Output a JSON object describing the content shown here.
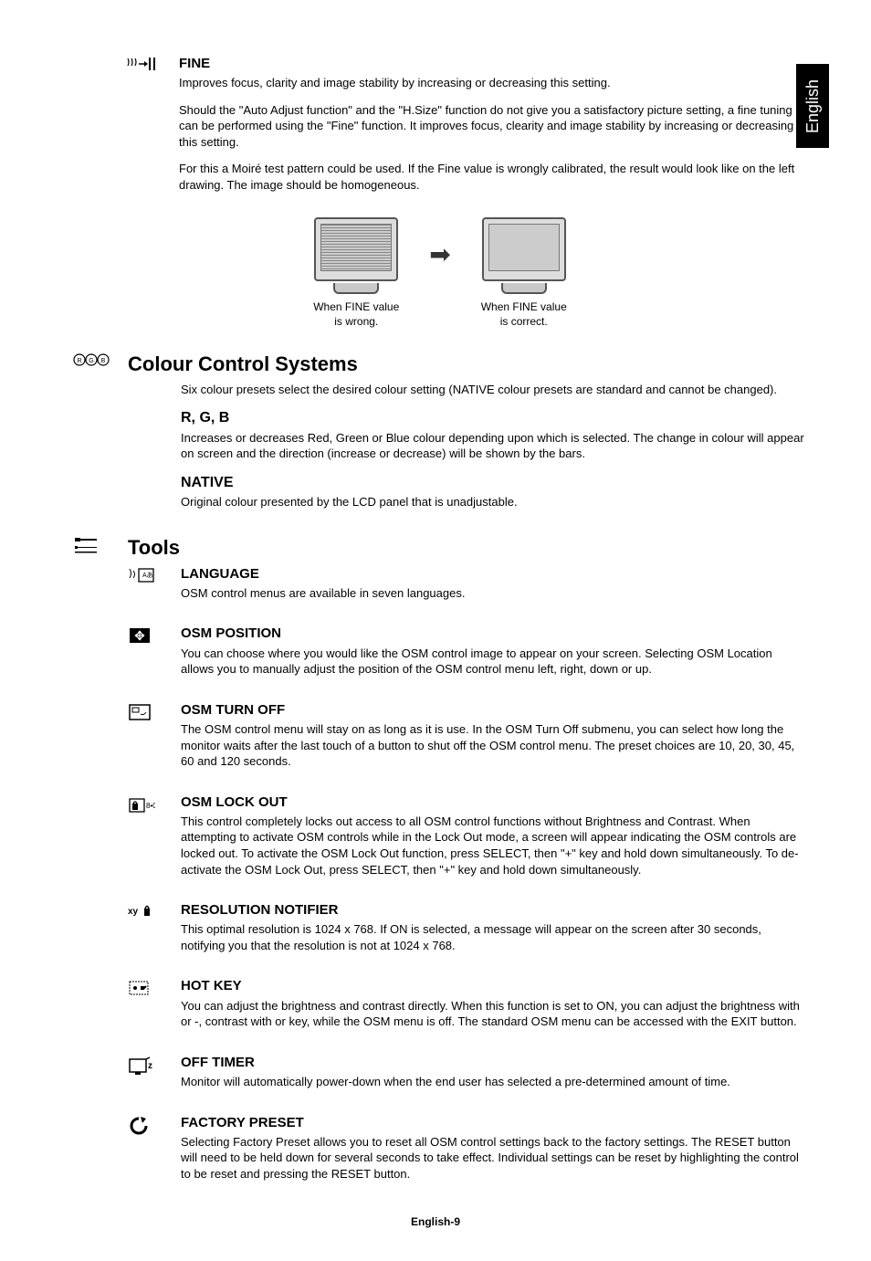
{
  "langTab": "English",
  "fine": {
    "heading": "FINE",
    "p1": "Improves focus, clarity and image stability by increasing or decreasing this setting.",
    "p2": "Should the \"Auto Adjust function\" and the \"H.Size\" function do not give you a satisfactory picture setting, a fine tuning can be performed using the \"Fine\" function. It improves focus, clearity and image stability by increasing or decreasing this setting.",
    "p3": "For this a Moiré test pattern could be used. If the Fine value is wrongly calibrated, the result would look like on the left drawing. The image should be homogeneous.",
    "capWrong": "When FINE value is wrong.",
    "capCorrect": "When FINE value is correct."
  },
  "colour": {
    "heading": "Colour Control Systems",
    "desc": "Six colour presets select the desired colour setting (NATIVE colour presets are standard and cannot be changed).",
    "rgbHeading": "R, G, B",
    "rgbDesc": "Increases or decreases Red, Green or Blue colour depending upon which is selected. The change in colour will appear on screen and the direction (increase or decrease) will be shown by the bars.",
    "nativeHeading": "NATIVE",
    "nativeDesc": "Original colour presented by the LCD panel that is unadjustable."
  },
  "tools": {
    "heading": "Tools",
    "language": {
      "heading": "LANGUAGE",
      "desc": "OSM control menus are available in seven languages."
    },
    "osmPosition": {
      "heading": "OSM POSITION",
      "desc": "You can choose where you would like the OSM control image to appear on your screen. Selecting OSM Location allows you to manually adjust the position of the OSM control menu left, right, down or up."
    },
    "osmTurnOff": {
      "heading": "OSM TURN OFF",
      "desc": "The OSM control menu will stay on as long as it is use. In the OSM Turn Off submenu, you can select how long the monitor waits after the last touch of a button to shut off the OSM control menu. The preset choices are 10, 20, 30, 45, 60 and 120 seconds."
    },
    "osmLockOut": {
      "heading": "OSM LOCK OUT",
      "desc": "This control completely locks out access to all OSM control functions without Brightness and Contrast. When attempting to activate OSM controls while in the Lock Out mode, a screen will appear indicating the OSM controls are locked out. To activate the OSM Lock Out function, press SELECT, then \"+\" key and hold down simultaneously. To de-activate the OSM Lock Out, press SELECT, then \"+\" key and hold down simultaneously."
    },
    "resolutionNotifier": {
      "heading": "RESOLUTION NOTIFIER",
      "desc": "This optimal resolution is 1024 x 768. If ON is selected, a message will appear on the screen after 30 seconds, notifying you that the resolution is not at 1024 x 768."
    },
    "hotKey": {
      "heading": "HOT KEY",
      "desc": "You can adjust the brightness and contrast directly. When this function is set to ON, you can adjust the brightness with    or -, contrast with    or  key, while the OSM menu is off. The standard OSM menu can be accessed with the EXIT button."
    },
    "offTimer": {
      "heading": "OFF TIMER",
      "desc": "Monitor will automatically power-down when the end user has selected a pre-determined amount of time."
    },
    "factoryPreset": {
      "heading": "FACTORY PRESET",
      "desc": "Selecting Factory Preset allows you to reset all OSM control settings back to the factory settings. The RESET button will need to be held down for several seconds to take effect. Individual settings can be reset by highlighting the control to be reset and pressing the RESET button."
    }
  },
  "footer": "English-9"
}
